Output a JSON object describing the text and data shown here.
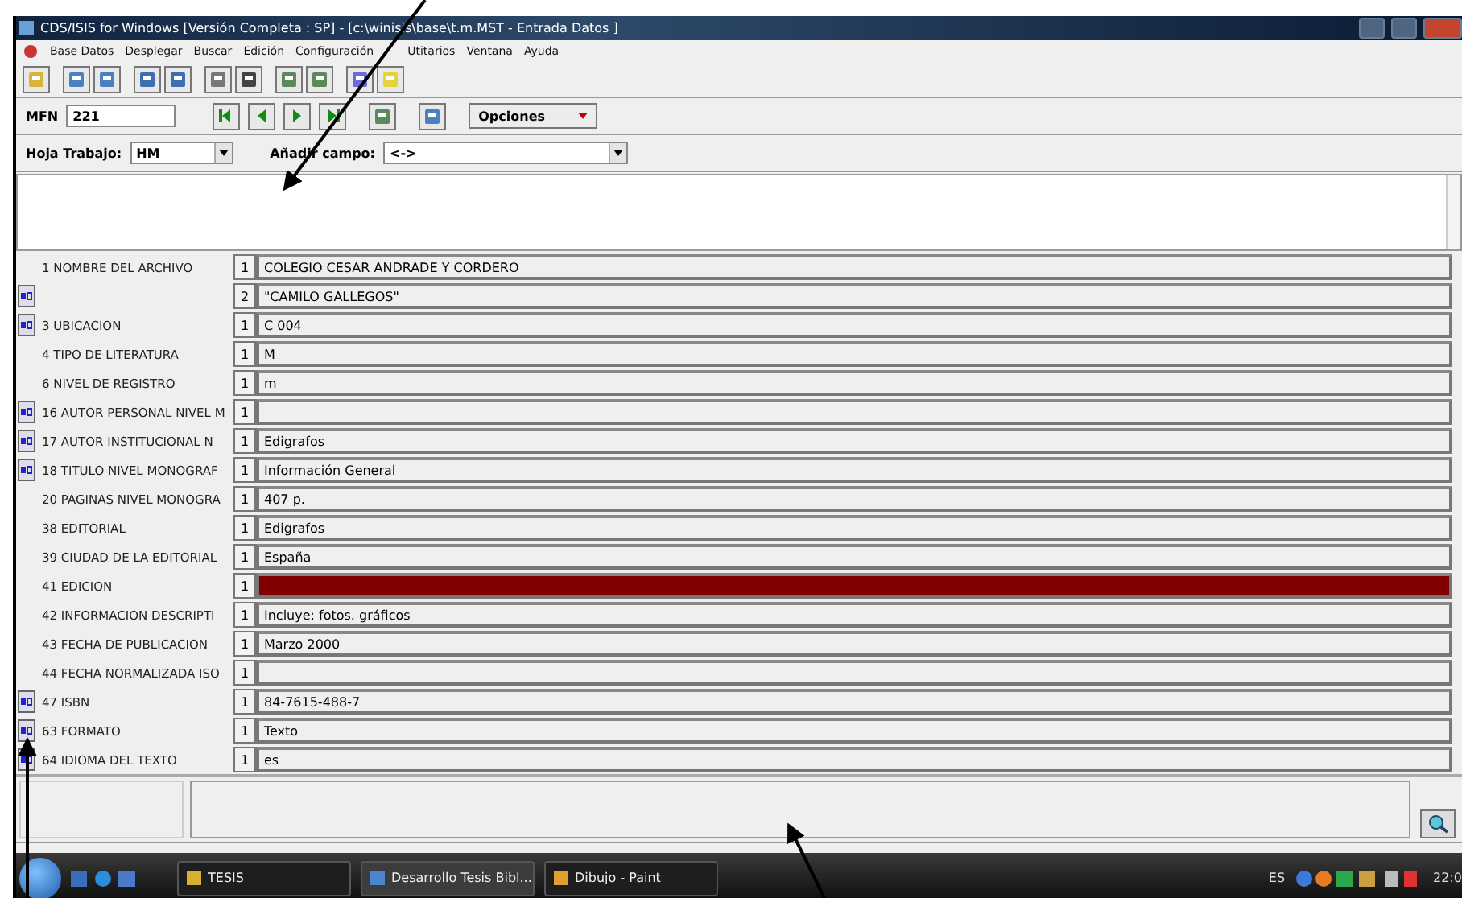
{
  "window": {
    "title": "CDS/ISIS for Windows [Versión Completa : SP] - [c:\\winisis\\base\\t.m.MST - Entrada Datos ]"
  },
  "menu": [
    "Base Datos",
    "Desplegar",
    "Buscar",
    "Edición",
    "Configuración",
    "Utitarios",
    "Ventana",
    "Ayuda"
  ],
  "record_bar": {
    "mfn_label": "MFN",
    "mfn_value": "221",
    "options_label": "Opciones"
  },
  "worksheet_bar": {
    "worksheet_label": "Hoja Trabajo:",
    "worksheet_value": "HM",
    "add_field_label": "Añadir campo:",
    "add_field_value": "<->"
  },
  "fields": [
    {
      "label": "1 NOMBRE DEL ARCHIVO",
      "occurrence": "1",
      "value": "COLEGIO CESAR ANDRADE Y CORDERO",
      "editor_button": false,
      "selected": false
    },
    {
      "occurrence": "2",
      "value": "\"CAMILO GALLEGOS\"",
      "editor_button": true,
      "selected": false
    },
    {
      "label": "3 UBICACION",
      "occurrence": "1",
      "value": "C 004",
      "editor_button": true,
      "selected": false
    },
    {
      "label": "4 TIPO DE LITERATURA",
      "occurrence": "1",
      "value": "M",
      "editor_button": false,
      "selected": false
    },
    {
      "label": "6 NIVEL DE REGISTRO",
      "occurrence": "1",
      "value": "m",
      "editor_button": false,
      "selected": false
    },
    {
      "label": "16 AUTOR PERSONAL NIVEL M",
      "occurrence": "1",
      "editor_button": true,
      "selected": false
    },
    {
      "label": "17 AUTOR INSTITUCIONAL N",
      "occurrence": "1",
      "value": "Edigrafos",
      "editor_button": true,
      "selected": false
    },
    {
      "label": "18 TITULO NIVEL MONOGRAF",
      "occurrence": "1",
      "value": "Información General",
      "editor_button": true,
      "selected": false
    },
    {
      "label": "20 PAGINAS NIVEL MONOGRA",
      "occurrence": "1",
      "value": "407 p.",
      "editor_button": false,
      "selected": false
    },
    {
      "label": "38 EDITORIAL",
      "occurrence": "1",
      "value": "Edigrafos",
      "editor_button": false,
      "selected": false
    },
    {
      "label": "39 CIUDAD DE LA EDITORIAL",
      "occurrence": "1",
      "value": "España",
      "editor_button": false,
      "selected": false
    },
    {
      "label": "41 EDICION",
      "occurrence": "1",
      "editor_button": false,
      "selected": true
    },
    {
      "label": "42 INFORMACION DESCRIPTI",
      "occurrence": "1",
      "value": "Incluye: fotos. gráficos",
      "editor_button": false,
      "selected": false
    },
    {
      "label": "43 FECHA DE PUBLICACION",
      "occurrence": "1",
      "value": "Marzo 2000",
      "editor_button": false,
      "selected": false
    },
    {
      "label": "44 FECHA NORMALIZADA ISO",
      "occurrence": "1",
      "editor_button": false,
      "selected": false
    },
    {
      "label": "47 ISBN",
      "occurrence": "1",
      "value": "84-7615-488-7",
      "editor_button": true,
      "selected": false
    },
    {
      "label": "63 FORMATO",
      "occurrence": "1",
      "value": "Texto",
      "editor_button": true,
      "selected": false
    },
    {
      "label": "64 IDIOMA DEL TEXTO",
      "occurrence": "1",
      "value": "es",
      "editor_button": true,
      "selected": false
    }
  ],
  "taskbar": {
    "items": [
      {
        "label": "TESIS",
        "selected": false
      },
      {
        "label": "Desarrollo Tesis Bibl...",
        "selected": true
      },
      {
        "label": "Dibujo - Paint",
        "selected": false
      }
    ],
    "language": "ES",
    "clock": "22:0"
  }
}
